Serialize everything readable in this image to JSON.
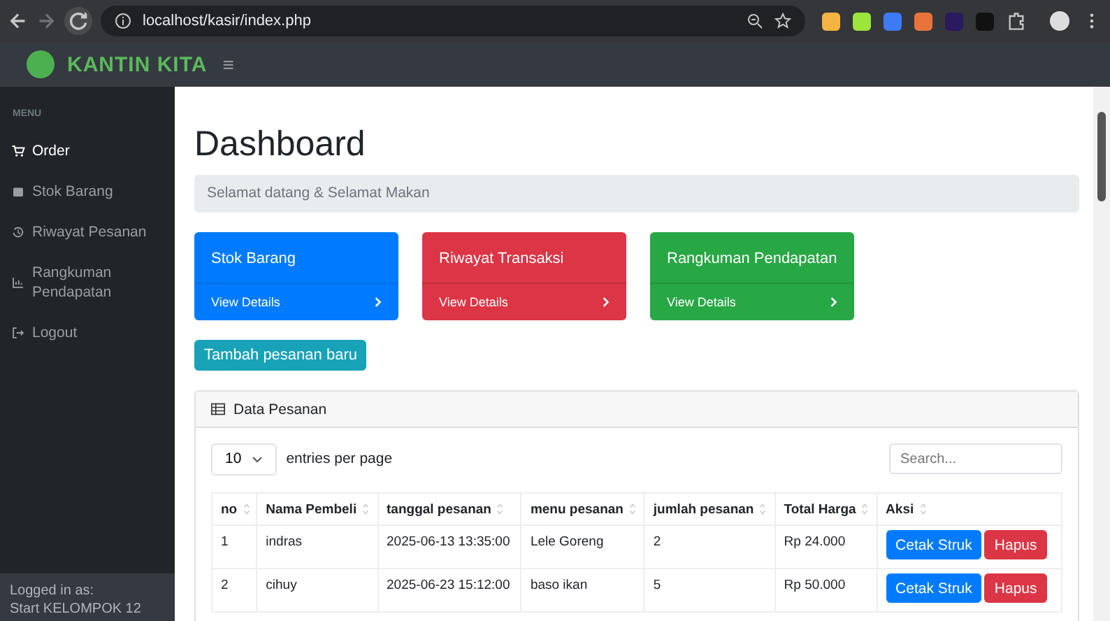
{
  "browser": {
    "url": "localhost/kasir/index.php"
  },
  "navbar": {
    "brand": "KANTIN KITA",
    "toggle": "≡"
  },
  "sidebar": {
    "heading": "MENU",
    "items": [
      {
        "label": "Order",
        "selected": true
      },
      {
        "label": "Stok Barang",
        "selected": false
      },
      {
        "label": "Riwayat Pesanan",
        "selected": false
      },
      {
        "label": "Rangkuman Pendapatan",
        "selected": false
      },
      {
        "label": "Logout",
        "selected": false
      }
    ],
    "footer": {
      "caption": "Logged in as:",
      "user": "Start KELOMPOK 12"
    }
  },
  "page": {
    "title": "Dashboard",
    "breadcrumb": "Selamat datang & Selamat Makan",
    "cards": [
      {
        "title": "Stok Barang",
        "link": "View Details",
        "color": "#007bff"
      },
      {
        "title": "Riwayat Transaksi",
        "link": "View Details",
        "color": "#dc3545"
      },
      {
        "title": "Rangkuman Pendapatan",
        "link": "View Details",
        "color": "#28a745"
      }
    ],
    "add_button": "Tambah pesanan baru"
  },
  "table_card": {
    "title": "Data Pesanan",
    "page_size": "10",
    "page_size_label": "entries per page",
    "search_placeholder": "Search...",
    "columns": [
      "no",
      "Nama Pembeli",
      "tanggal pesanan",
      "menu pesanan",
      "jumlah pesanan",
      "Total Harga",
      "Aksi"
    ],
    "rows": [
      {
        "cells": [
          "1",
          "indras",
          "2025-06-13 13:35:00",
          "Lele Goreng",
          "2",
          "Rp 24.000"
        ],
        "actions": [
          "Cetak Struk",
          "Hapus"
        ]
      },
      {
        "cells": [
          "2",
          "cihuy",
          "2025-06-23 15:12:00",
          "baso ikan",
          "5",
          "Rp 50.000"
        ],
        "actions": [
          "Cetak Struk",
          "Hapus"
        ]
      }
    ]
  }
}
